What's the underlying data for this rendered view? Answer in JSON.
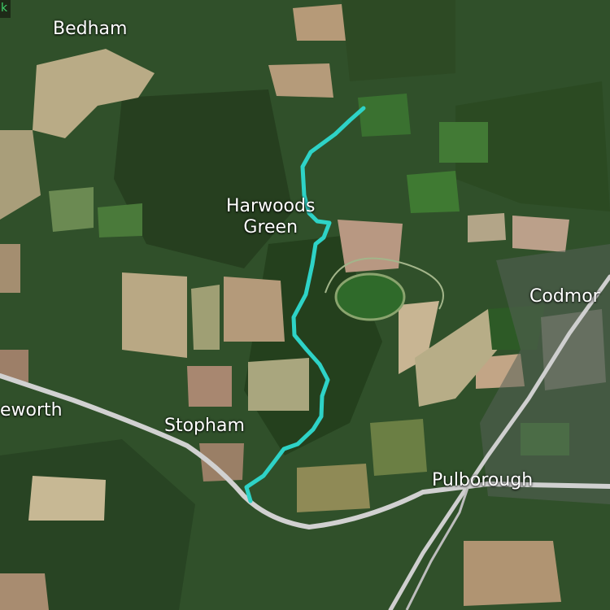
{
  "map": {
    "corner_glyph": "k",
    "place_labels": {
      "bedham": "Bedham",
      "harwoods_line1": "Harwoods",
      "harwoods_line2": "Green",
      "codmore": "Codmor",
      "eworth": "eworth",
      "stopham": "Stopham",
      "pulborough": "Pulborough"
    },
    "colors": {
      "route": "#2ed3c7",
      "road": "#cfcfcf",
      "label_text": "#ffffff"
    }
  }
}
